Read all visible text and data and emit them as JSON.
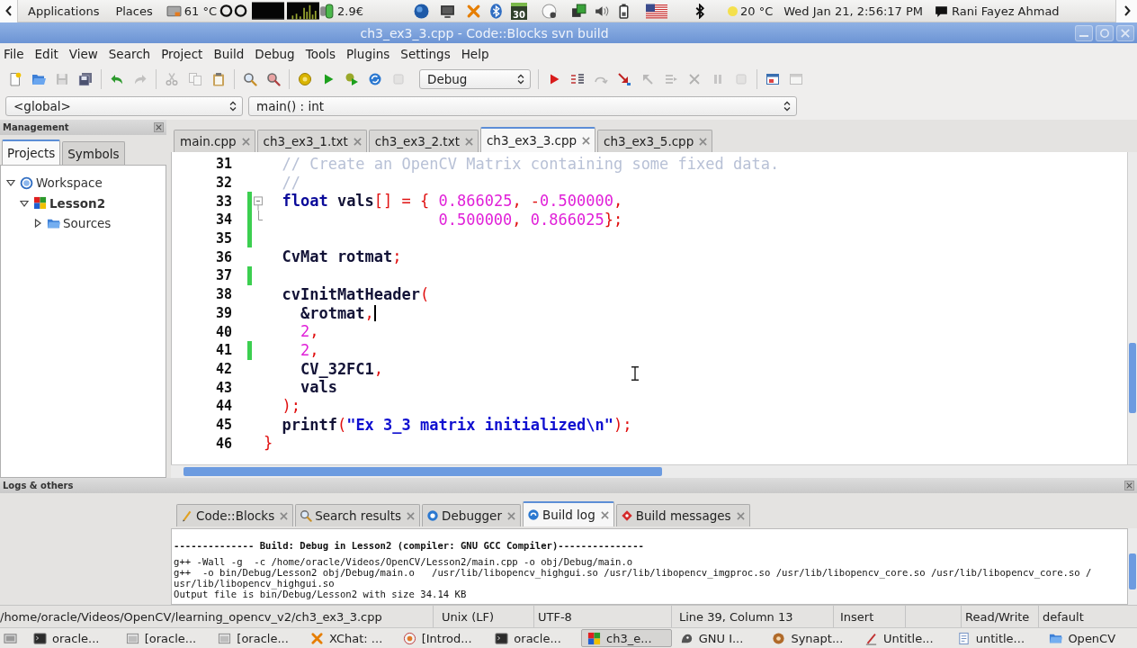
{
  "top_panel": {
    "menus": [
      "Applications",
      "Places"
    ],
    "cpu_temperature": "61 °C",
    "network_rate": "2.9€",
    "calendar_day": "30",
    "weather": "20 °C",
    "clock": "Wed Jan 21, 2:56:17 PM",
    "user": "Rani Fayez Ahmad"
  },
  "window": {
    "title": "ch3_ex3_3.cpp - Code::Blocks svn build"
  },
  "menu_bar": [
    "File",
    "Edit",
    "View",
    "Search",
    "Project",
    "Build",
    "Debug",
    "Tools",
    "Plugins",
    "Settings",
    "Help"
  ],
  "toolbar": {
    "left_groups": [
      [
        {
          "kind": "new",
          "disabled": false
        },
        {
          "kind": "open",
          "disabled": false
        },
        {
          "kind": "save",
          "disabled": true
        },
        {
          "kind": "saveall",
          "disabled": false
        }
      ],
      [
        {
          "kind": "undo",
          "disabled": false
        },
        {
          "kind": "redo",
          "disabled": true
        }
      ],
      [
        {
          "kind": "cut",
          "disabled": true
        },
        {
          "kind": "copy",
          "disabled": true
        },
        {
          "kind": "paste",
          "disabled": false
        }
      ],
      [
        {
          "kind": "find",
          "disabled": false
        },
        {
          "kind": "replace",
          "disabled": false
        }
      ],
      [
        {
          "kind": "build",
          "disabled": false
        },
        {
          "kind": "run",
          "disabled": false
        },
        {
          "kind": "buildrun",
          "disabled": false
        },
        {
          "kind": "rebuild",
          "disabled": false
        },
        {
          "kind": "abort",
          "disabled": true
        }
      ]
    ],
    "build_target": "Debug",
    "right_groups": [
      [
        {
          "kind": "debug",
          "disabled": false
        },
        {
          "kind": "runcursor",
          "disabled": false
        },
        {
          "kind": "next",
          "disabled": true
        },
        {
          "kind": "stepin",
          "disabled": false
        },
        {
          "kind": "stepout",
          "disabled": true
        },
        {
          "kind": "nexti",
          "disabled": true
        },
        {
          "kind": "stepi",
          "disabled": true
        },
        {
          "kind": "pause",
          "disabled": true
        },
        {
          "kind": "stop",
          "disabled": true
        }
      ],
      [
        {
          "kind": "windows",
          "disabled": false
        },
        {
          "kind": "info",
          "disabled": true
        }
      ]
    ]
  },
  "code_navigation": {
    "scope": "<global>",
    "function": "main() : int"
  },
  "management": {
    "title": "Management",
    "tabs": [
      {
        "label": "Projects",
        "selected": true
      },
      {
        "label": "Symbols",
        "selected": false
      }
    ],
    "tree": [
      {
        "label": "Workspace",
        "kind": "workspace",
        "expanded": true,
        "active": false,
        "children": [
          {
            "label": "Lesson2",
            "kind": "project",
            "expanded": true,
            "active": true,
            "children": [
              {
                "label": "Sources",
                "kind": "folder",
                "expanded": false,
                "active": false
              }
            ]
          }
        ]
      }
    ]
  },
  "editor": {
    "tabs": [
      {
        "label": "main.cpp",
        "selected": false
      },
      {
        "label": "ch3_ex3_1.txt",
        "selected": false
      },
      {
        "label": "ch3_ex3_2.txt",
        "selected": false
      },
      {
        "label": "ch3_ex3_3.cpp",
        "selected": true
      },
      {
        "label": "ch3_ex3_5.cpp",
        "selected": false
      }
    ],
    "lines": [
      {
        "number": "31",
        "changed": false,
        "fold_start": false,
        "fold_end": false,
        "caret": false,
        "tokens": [
          {
            "kind": "comment",
            "text": "  // Create an OpenCV Matrix containing some fixed data."
          }
        ]
      },
      {
        "number": "32",
        "changed": false,
        "fold_start": false,
        "fold_end": false,
        "caret": false,
        "tokens": [
          {
            "kind": "comment",
            "text": "  //"
          }
        ]
      },
      {
        "number": "33",
        "changed": true,
        "fold_start": true,
        "fold_end": false,
        "caret": false,
        "tokens": [
          {
            "kind": "keyword",
            "text": "  float"
          },
          {
            "kind": "ident",
            "text": " vals"
          },
          {
            "kind": "op",
            "text": "[] = {"
          },
          {
            "kind": "number",
            "text": " 0.866025"
          },
          {
            "kind": "op",
            "text": ", -"
          },
          {
            "kind": "number",
            "text": "0.500000"
          },
          {
            "kind": "op",
            "text": ","
          }
        ]
      },
      {
        "number": "34",
        "changed": true,
        "fold_start": false,
        "fold_end": true,
        "caret": false,
        "tokens": [
          {
            "kind": "number",
            "text": "                   0.500000"
          },
          {
            "kind": "op",
            "text": ","
          },
          {
            "kind": "number",
            "text": " 0.866025"
          },
          {
            "kind": "op",
            "text": "};"
          }
        ]
      },
      {
        "number": "35",
        "changed": true,
        "fold_start": false,
        "fold_end": false,
        "caret": false
      },
      {
        "number": "36",
        "changed": false,
        "fold_start": false,
        "fold_end": false,
        "caret": false,
        "tokens": [
          {
            "kind": "ident",
            "text": "  CvMat rotmat"
          },
          {
            "kind": "op",
            "text": ";"
          }
        ]
      },
      {
        "number": "37",
        "changed": true,
        "fold_start": false,
        "fold_end": false,
        "caret": false
      },
      {
        "number": "38",
        "changed": false,
        "fold_start": false,
        "fold_end": false,
        "caret": false,
        "tokens": [
          {
            "kind": "ident",
            "text": "  cvInitMatHeader"
          },
          {
            "kind": "op",
            "text": "("
          }
        ]
      },
      {
        "number": "39",
        "changed": false,
        "fold_start": false,
        "fold_end": false,
        "caret": true,
        "tokens": [
          {
            "kind": "ident",
            "text": "    &rotmat"
          },
          {
            "kind": "op",
            "text": ","
          }
        ]
      },
      {
        "number": "40",
        "changed": false,
        "fold_start": false,
        "fold_end": false,
        "caret": false,
        "tokens": [
          {
            "kind": "number",
            "text": "    2"
          },
          {
            "kind": "op",
            "text": ","
          }
        ]
      },
      {
        "number": "41",
        "changed": true,
        "fold_start": false,
        "fold_end": false,
        "caret": false,
        "tokens": [
          {
            "kind": "number",
            "text": "    2"
          },
          {
            "kind": "op",
            "text": ","
          }
        ]
      },
      {
        "number": "42",
        "changed": false,
        "fold_start": false,
        "fold_end": false,
        "caret": false,
        "tokens": [
          {
            "kind": "ident",
            "text": "    CV_32FC1"
          },
          {
            "kind": "op",
            "text": ","
          }
        ]
      },
      {
        "number": "43",
        "changed": false,
        "fold_start": false,
        "fold_end": false,
        "caret": false,
        "tokens": [
          {
            "kind": "ident",
            "text": "    vals"
          }
        ]
      },
      {
        "number": "44",
        "changed": false,
        "fold_start": false,
        "fold_end": false,
        "caret": false,
        "tokens": [
          {
            "kind": "op",
            "text": "  );"
          }
        ]
      },
      {
        "number": "45",
        "changed": false,
        "fold_start": false,
        "fold_end": false,
        "caret": false,
        "tokens": [
          {
            "kind": "ident",
            "text": "  printf"
          },
          {
            "kind": "op",
            "text": "("
          },
          {
            "kind": "string",
            "text": "\"Ex 3_3 matrix initialized\\n\""
          },
          {
            "kind": "op",
            "text": ");"
          }
        ]
      },
      {
        "number": "46",
        "changed": false,
        "fold_start": false,
        "fold_end": false,
        "caret": false,
        "tokens": [
          {
            "kind": "op",
            "text": "}"
          }
        ]
      }
    ]
  },
  "logs": {
    "title": "Logs & others",
    "tabs": [
      {
        "label": "Code::Blocks",
        "kind": "codeblocks",
        "selected": false
      },
      {
        "label": "Search results",
        "kind": "search",
        "selected": false
      },
      {
        "label": "Debugger",
        "kind": "debugger",
        "selected": false
      },
      {
        "label": "Build log",
        "kind": "buildlog",
        "selected": true
      },
      {
        "label": "Build messages",
        "kind": "messages",
        "selected": false
      }
    ],
    "lines": [
      {
        "kind": "heading",
        "text": "-------------- Build: Debug in Lesson2 (compiler: GNU GCC Compiler)---------------"
      },
      {
        "kind": "output",
        "text": "g++ -Wall -g  -c /home/oracle/Videos/OpenCV/Lesson2/main.cpp -o obj/Debug/main.o"
      },
      {
        "kind": "output",
        "text": "g++  -o bin/Debug/Lesson2 obj/Debug/main.o   /usr/lib/libopencv_highgui.so /usr/lib/libopencv_imgproc.so /usr/lib/libopencv_core.so /usr/lib/libopencv_core.so /"
      },
      {
        "kind": "output",
        "text": "usr/lib/libopencv_highgui.so"
      },
      {
        "kind": "output",
        "text": "Output file is bin/Debug/Lesson2 with size 34.14 KB"
      }
    ]
  },
  "status_bar": {
    "file_path": "/home/oracle/Videos/OpenCV/learning_opencv_v2/ch3_ex3_3.cpp",
    "line_endings": "Unix (LF)",
    "encoding": "UTF-8",
    "position": "Line 39, Column 13",
    "mode": "Insert",
    "access": "Read/Write",
    "profile": "default"
  },
  "taskbar": [
    {
      "label": "oracle...",
      "kind": "terminal",
      "selected": false
    },
    {
      "label": "[oracle...",
      "kind": "files",
      "selected": false
    },
    {
      "label": "[oracle...",
      "kind": "files",
      "selected": false
    },
    {
      "label": "XChat: ...",
      "kind": "chat",
      "selected": false
    },
    {
      "label": "[Introd...",
      "kind": "browser",
      "selected": false
    },
    {
      "label": "oracle...",
      "kind": "terminal",
      "selected": false
    },
    {
      "label": "ch3_e...",
      "kind": "ide",
      "selected": true
    },
    {
      "label": "GNU I...",
      "kind": "graphics",
      "selected": false
    },
    {
      "label": "Synapt...",
      "kind": "packages",
      "selected": false
    },
    {
      "label": "Untitle...",
      "kind": "editor",
      "selected": false
    },
    {
      "label": "untitle...",
      "kind": "notes",
      "selected": false
    },
    {
      "label": "OpenCV",
      "kind": "folder",
      "selected": false
    }
  ]
}
